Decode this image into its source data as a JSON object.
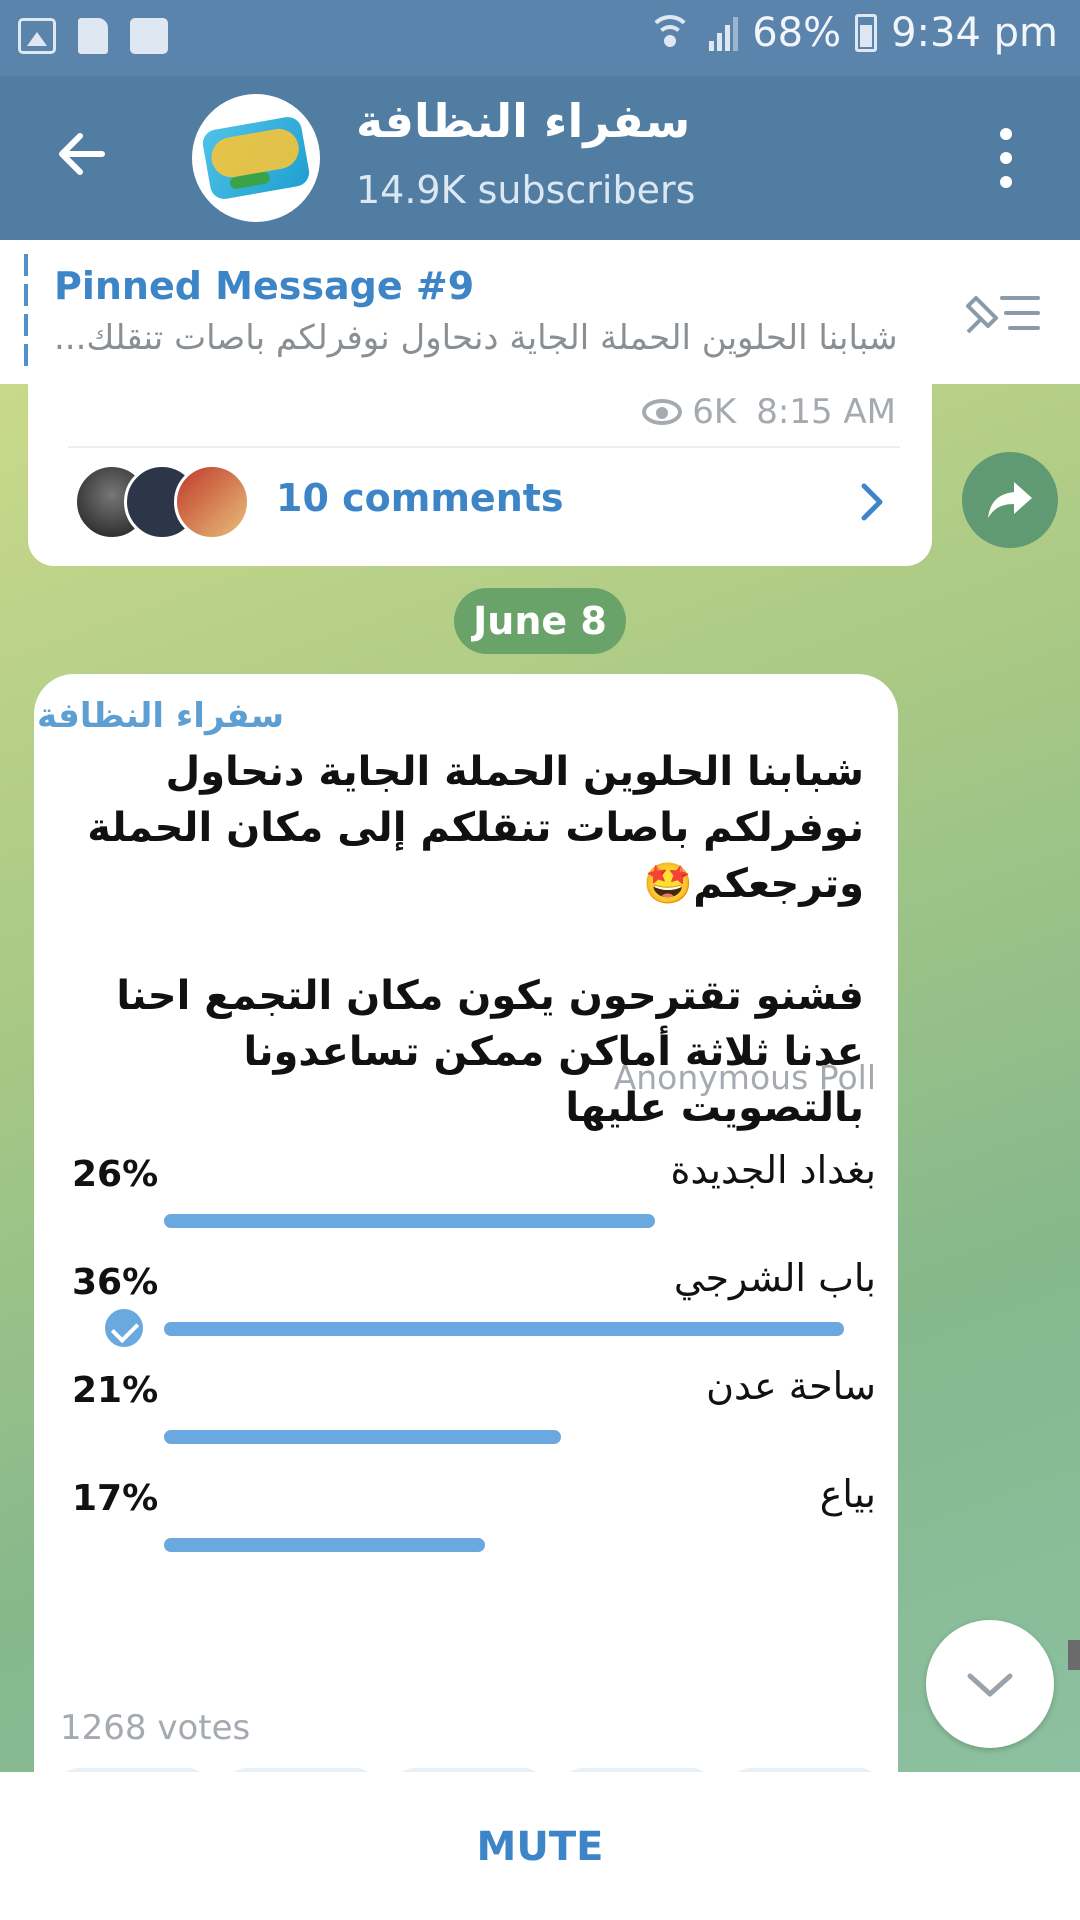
{
  "status_bar": {
    "battery": "68%",
    "time": "9:34 pm",
    "icons": [
      "gallery-icon",
      "sd-card-icon",
      "activity-icon",
      "wifi-icon",
      "signal-icon",
      "battery-icon"
    ]
  },
  "header": {
    "title": "سفراء النظافة",
    "subtitle": "14.9K subscribers",
    "back_icon": "arrow-left-icon",
    "menu_icon": "more-vertical-icon"
  },
  "pinned": {
    "title": "Pinned Message #9",
    "text": "شبابنا الحلوين الحملة الجاية دنحاول نوفرلكم باصات تنقلك..."
  },
  "prev_post": {
    "views": "6K",
    "time": "8:15 AM",
    "comments": "10 comments"
  },
  "date_label": "June 8",
  "poll_post": {
    "author": "سفراء النظافة",
    "paragraph_1": "شبابنا الحلوين الحملة الجاية دنحاول نوفرلكم باصات تنقلكم إلى مكان الحملة وترجعكم🤩",
    "paragraph_2": "فشنو تقترحون يكون مكان التجمع احنا عدنا ثلاثة أماكن ممكن تساعدونا بالتصويت عليها",
    "poll_type": "Anonymous Poll",
    "options": [
      {
        "label": "بغداد الجديدة",
        "percent": "26%",
        "value": 26,
        "chosen": false
      },
      {
        "label": "باب الشرجي",
        "percent": "36%",
        "value": 36,
        "chosen": true
      },
      {
        "label": "ساحة عدن",
        "percent": "21%",
        "value": 21,
        "chosen": false
      },
      {
        "label": "بياع",
        "percent": "17%",
        "value": 17,
        "chosen": false
      }
    ],
    "votes": "1268 votes"
  },
  "bottom": {
    "mute_label": "MUTE"
  },
  "colors": {
    "header": "#517da2",
    "status_bar": "#5b84ac",
    "accent": "#3d85c6",
    "poll_bar": "#6aa8e0"
  }
}
